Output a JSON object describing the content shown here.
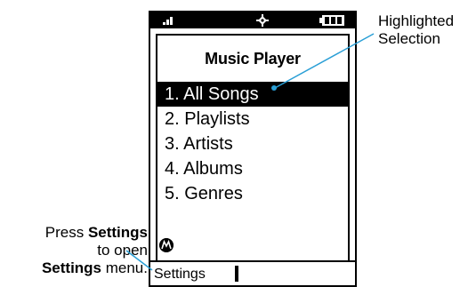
{
  "status_icons": {
    "signal": "signal-strength-icon",
    "gps": "gps-target-icon",
    "battery": "battery-icon"
  },
  "screen": {
    "title": "Music Player",
    "menu": [
      {
        "label": "1. All Songs",
        "selected": true
      },
      {
        "label": "2. Playlists",
        "selected": false
      },
      {
        "label": "3. Artists",
        "selected": false
      },
      {
        "label": "4. Albums",
        "selected": false
      },
      {
        "label": "5. Genres",
        "selected": false
      }
    ],
    "logo_icon": "motorola-logo-icon"
  },
  "softkeys": {
    "left_label": "Settings"
  },
  "callouts": {
    "highlight_line1": "Highlighted",
    "highlight_line2": "Selection",
    "press_prefix": "Press ",
    "press_key": "Settings",
    "to_open": "to open",
    "menu_key": "Settings",
    "menu_suffix": " menu."
  }
}
